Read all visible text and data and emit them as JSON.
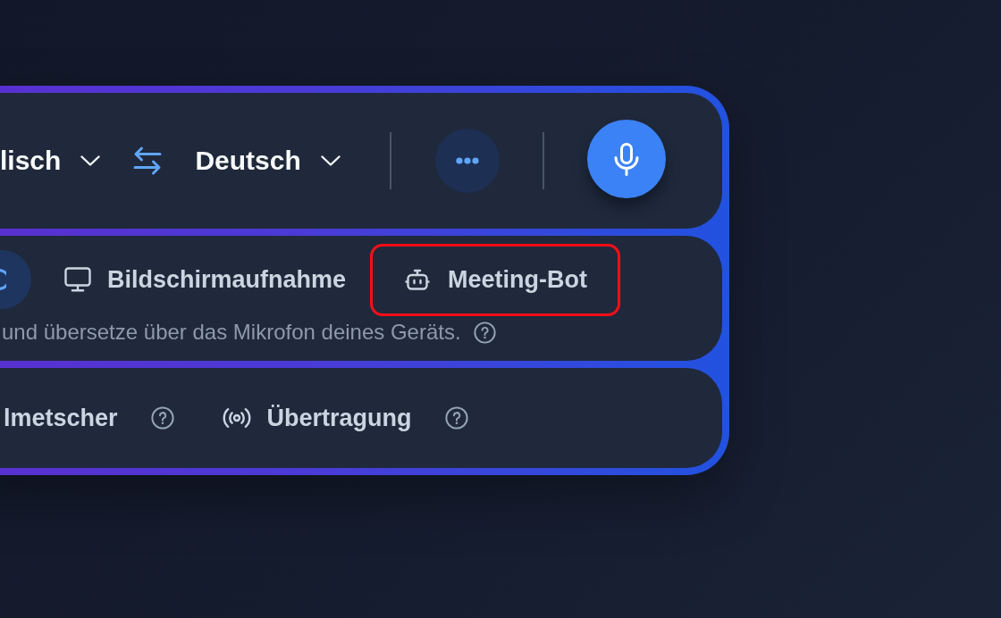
{
  "language_bar": {
    "source_language": "lisch",
    "target_language": "Deutsch"
  },
  "capture_modes": [
    {
      "kind": "partial",
      "selected": true
    },
    {
      "kind": "screen",
      "label": "Bildschirmaufnahme",
      "selected": false
    },
    {
      "kind": "bot",
      "label": "Meeting-Bot",
      "selected": false,
      "highlighted": true
    }
  ],
  "mode_description": "und übersetze über das Mikrofon deines Geräts.",
  "features": [
    {
      "kind": "plain",
      "label": "lmetscher"
    },
    {
      "kind": "broadcast",
      "label": "Übertragung"
    }
  ]
}
